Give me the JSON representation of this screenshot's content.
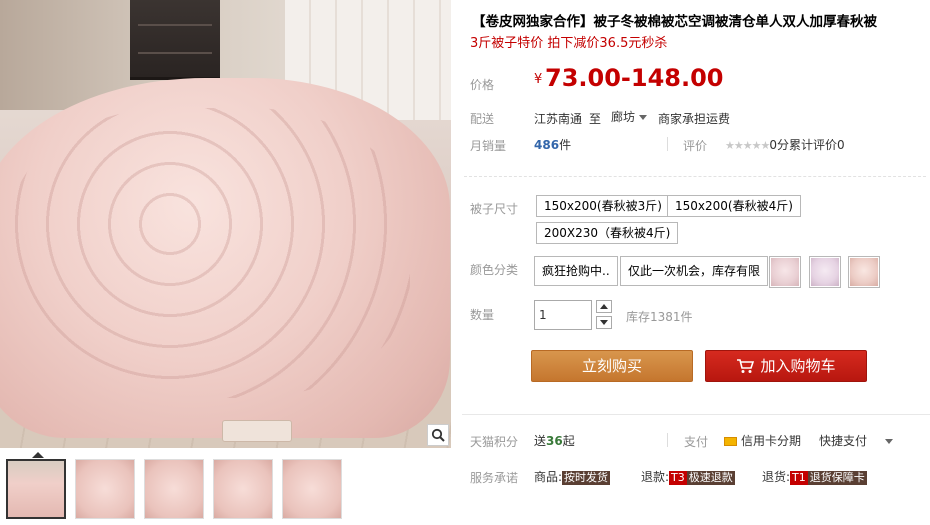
{
  "product": {
    "title": "【卷皮网独家合作】被子冬被棉被芯空调被清仓单人双人加厚春秋被",
    "subtitle": "3斤被子特价 拍下减价36.5元秒杀"
  },
  "price": {
    "label": "价格",
    "currency": "¥",
    "value": "73.00-148.00"
  },
  "shipping": {
    "label": "配送",
    "from": "江苏南通",
    "to_word": "至",
    "destination": "廊坊",
    "fee_note": "商家承担运费"
  },
  "sales": {
    "label": "月销量",
    "count": "486",
    "unit": "件",
    "review_label": "评价",
    "stars": "★★★★★",
    "score_text": "0分",
    "review_count_text": "累计评价0"
  },
  "size": {
    "label": "被子尺寸",
    "options": [
      "150x200(春秋被3斤)",
      "150x200(春秋被4斤)",
      "200X230（春秋被4斤)"
    ]
  },
  "color": {
    "label": "颜色分类",
    "options": [
      "疯狂抢购中..",
      "仅此一次机会，库存有限"
    ],
    "swatch_icons": [
      "quilt-swatch-pink",
      "quilt-swatch-lilac",
      "quilt-swatch-peach"
    ]
  },
  "quantity": {
    "label": "数量",
    "value": "1",
    "stock_text": "库存1381件"
  },
  "actions": {
    "buy_now": "立刻购买",
    "add_to_cart": "加入购物车"
  },
  "points": {
    "label": "天猫积分",
    "prefix": "送",
    "value": "36",
    "suffix": "起",
    "pay_label": "支付",
    "credit_installment": "信用卡分期",
    "quick_pay": "快捷支付"
  },
  "service": {
    "label": "服务承诺",
    "goods_prefix": "商品:",
    "goods_tag": "按时发货",
    "refund_prefix": "退款:",
    "refund_badge": "T3",
    "refund_tag": "极速退款",
    "return_prefix": "退货:",
    "return_badge": "T1",
    "return_tag": "退货保障卡"
  },
  "colors": {
    "price_red": "#c40000",
    "buy_orange": "#c5762e",
    "cart_red": "#b8170f",
    "link_blue": "#3366aa"
  }
}
